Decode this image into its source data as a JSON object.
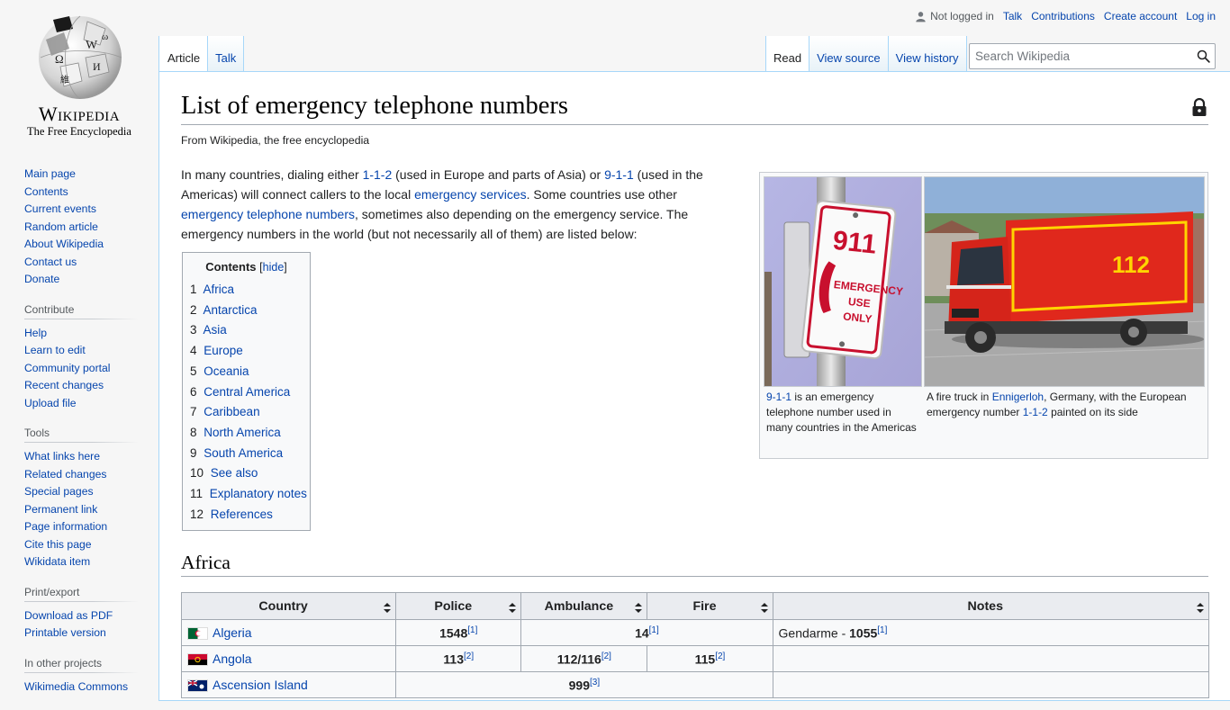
{
  "logo": {
    "wordmark": "Wikipedia",
    "tagline": "The Free Encyclopedia"
  },
  "personal": {
    "not_logged_in": "Not logged in",
    "talk": "Talk",
    "contributions": "Contributions",
    "create_account": "Create account",
    "login": "Log in"
  },
  "tabs_left": [
    "Article",
    "Talk"
  ],
  "tabs_right": [
    "Read",
    "View source",
    "View history"
  ],
  "search": {
    "placeholder": "Search Wikipedia"
  },
  "sidebar": {
    "navigation": [
      "Main page",
      "Contents",
      "Current events",
      "Random article",
      "About Wikipedia",
      "Contact us",
      "Donate"
    ],
    "contribute": {
      "heading": "Contribute",
      "items": [
        "Help",
        "Learn to edit",
        "Community portal",
        "Recent changes",
        "Upload file"
      ]
    },
    "tools": {
      "heading": "Tools",
      "items": [
        "What links here",
        "Related changes",
        "Special pages",
        "Permanent link",
        "Page information",
        "Cite this page",
        "Wikidata item"
      ]
    },
    "print": {
      "heading": "Print/export",
      "items": [
        "Download as PDF",
        "Printable version"
      ]
    },
    "projects": {
      "heading": "In other projects",
      "items": [
        "Wikimedia Commons"
      ]
    }
  },
  "article": {
    "title": "List of emergency telephone numbers",
    "site_sub": "From Wikipedia, the free encyclopedia",
    "lead": {
      "t1": "In many countries, dialing either ",
      "l1": "1-1-2",
      "t2": " (used in Europe and parts of Asia) or ",
      "l2": "9-1-1",
      "t3": " (used in the Americas) will connect callers to the local ",
      "l3": "emergency services",
      "t4": ". Some countries use other ",
      "l4": "emergency telephone numbers",
      "t5": ", sometimes also depending on the emergency service. The emergency numbers in the world (but not necessarily all of them) are listed below:"
    },
    "toc": {
      "title": "Contents",
      "hide": "hide",
      "items": [
        {
          "num": "1",
          "label": "Africa"
        },
        {
          "num": "2",
          "label": "Antarctica"
        },
        {
          "num": "3",
          "label": "Asia"
        },
        {
          "num": "4",
          "label": "Europe"
        },
        {
          "num": "5",
          "label": "Oceania"
        },
        {
          "num": "6",
          "label": "Central America"
        },
        {
          "num": "7",
          "label": "Caribbean"
        },
        {
          "num": "8",
          "label": "North America"
        },
        {
          "num": "9",
          "label": "South America"
        },
        {
          "num": "10",
          "label": "See also"
        },
        {
          "num": "11",
          "label": "Explanatory notes"
        },
        {
          "num": "12",
          "label": "References"
        }
      ]
    },
    "thumb": {
      "sign_text": [
        "911",
        "EMERGENCY",
        "USE",
        "ONLY"
      ],
      "truck_number": "112",
      "cap1_link": "9-1-1",
      "cap1_text": " is an emergency telephone number used in many countries in the Americas",
      "cap2_t1": "A fire truck in ",
      "cap2_link1": "Ennigerloh",
      "cap2_t2": ", Germany, with the European emergency number ",
      "cap2_link2": "1-1-2",
      "cap2_t3": " painted on its side"
    },
    "africa": {
      "heading": "Africa",
      "columns": [
        "Country",
        "Police",
        "Ambulance",
        "Fire",
        "Notes"
      ],
      "rows": [
        {
          "country": "Algeria",
          "police": "1548",
          "police_ref": "[1]",
          "ambfire": "14",
          "ambfire_ref": "[1]",
          "notes_prefix": "Gendarme - ",
          "notes_bold": "1055",
          "notes_ref": "[1]"
        },
        {
          "country": "Angola",
          "police": "113",
          "police_ref": "[2]",
          "ambulance": "112/116",
          "ambulance_ref": "[2]",
          "fire": "115",
          "fire_ref": "[2]"
        },
        {
          "country": "Ascension Island",
          "all": "999",
          "all_ref": "[3]"
        }
      ]
    }
  },
  "colors": {
    "link": "#0645ad",
    "border": "#a2a9b1",
    "tab_border": "#a7d7f9",
    "truck_red": "#e0281c",
    "sign_red": "#c8102e"
  }
}
